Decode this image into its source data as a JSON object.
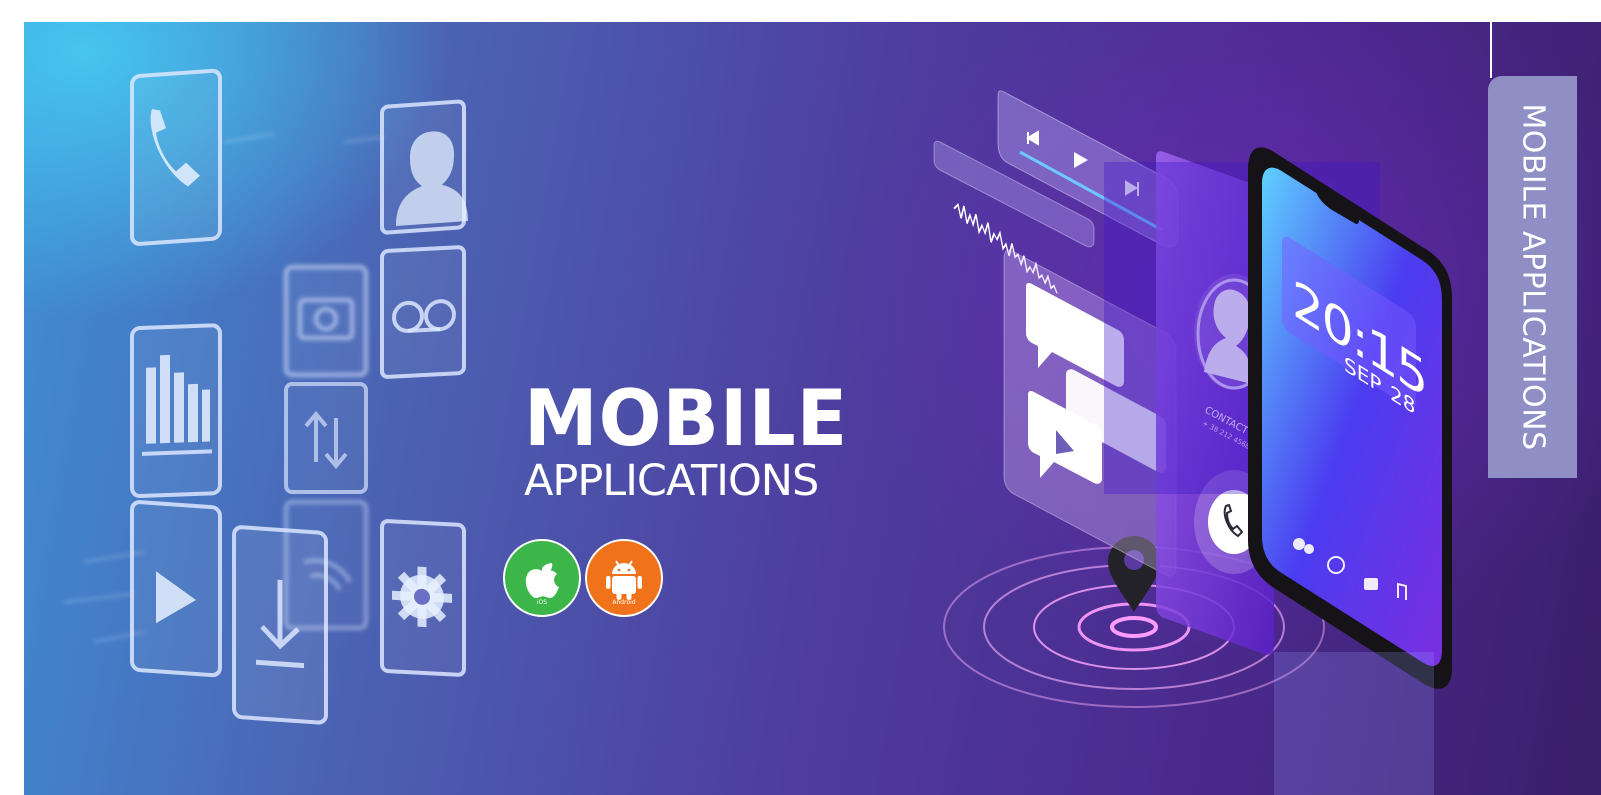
{
  "hero": {
    "title": "MOBILE",
    "subtitle": "APPLICATIONS"
  },
  "platform_badges": [
    {
      "label": "iOS",
      "color": "#3cb648",
      "icon": "apple-icon"
    },
    {
      "label": "Android",
      "color": "#f0731c",
      "icon": "android-icon"
    }
  ],
  "side_tab": {
    "label": "MOBILE APPLICATIONS"
  },
  "phone": {
    "clock": "20:15",
    "month": "SEP",
    "day": "28",
    "contact_name": "CONTACT NAME",
    "contact_number": "+ 38 212 456882"
  },
  "app_icons": [
    "phone-icon",
    "contact-icon",
    "camera-icon",
    "voicemail-icon",
    "chart-icon",
    "transfer-icon",
    "play-icon",
    "download-icon",
    "wifi-icon",
    "gear-icon"
  ],
  "colors": {
    "gradient_start": "#46c8f0",
    "gradient_end": "#3a1f6b",
    "ios_green": "#3cb648",
    "android_orange": "#f0731c",
    "side_tab": "#8f8fc6"
  }
}
